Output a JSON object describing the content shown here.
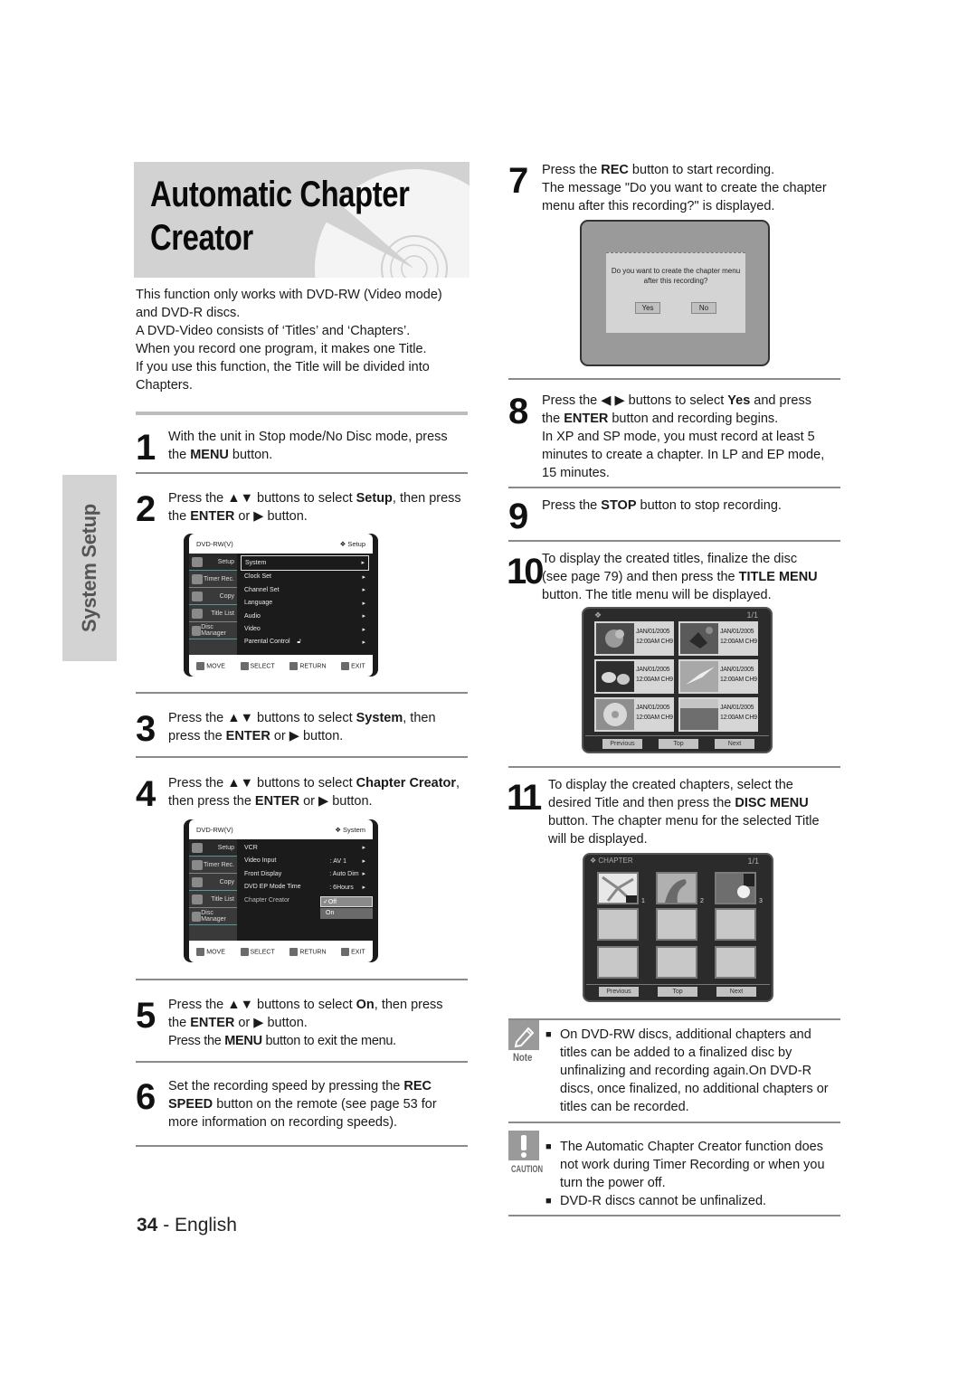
{
  "page": {
    "title_line1": "Automatic Chapter",
    "title_line2": "Creator",
    "side_tab": "System Setup",
    "footer_number": "34",
    "footer_sep": " - ",
    "footer_lang": "English"
  },
  "intro": [
    "This function only works with DVD-RW (Video mode)",
    "and DVD-R discs.",
    "A DVD-Video consists of ‘Titles’ and ‘Chapters’.",
    "When you record one program, it makes one Title.",
    "If you use this function, the Title will be divided into",
    "Chapters."
  ],
  "steps": {
    "s1": {
      "num": "1",
      "l1a": "With the unit in Stop mode/No Disc mode, press",
      "l2a": "the ",
      "l2b": "MENU",
      "l2c": " button."
    },
    "s2": {
      "num": "2",
      "l1a": "Press the ▲▼ buttons to select ",
      "l1b": "Setup",
      "l1c": ", then press",
      "l2a": "the ",
      "l2b": "ENTER",
      "l2c": " or ▶ button."
    },
    "s3": {
      "num": "3",
      "l1a": "Press the ▲▼ buttons to select ",
      "l1b": "System",
      "l1c": ", then",
      "l2a": "press the ",
      "l2b": "ENTER",
      "l2c": " or ▶ button."
    },
    "s4": {
      "num": "4",
      "l1a": "Press the ▲▼ buttons to select ",
      "l1b": "Chapter Creator",
      "l1c": ",",
      "l2a": "then press the ",
      "l2b": "ENTER",
      "l2c": " or ▶ button."
    },
    "s5": {
      "num": "5",
      "l1a": "Press the ▲▼ buttons to select ",
      "l1b": "On",
      "l1c": ", then press",
      "l2a": "the ",
      "l2b": "ENTER",
      "l2c": " or ▶ button.",
      "l3a": "Press the ",
      "l3b": "MENU",
      "l3c": " button to exit the menu."
    },
    "s6": {
      "num": "6",
      "l1a": "Set the recording speed by pressing the ",
      "l1b": "REC",
      "l2a": "SPEED",
      "l2b": " button on the remote (see page 53 for",
      "l3": "more information on recording speeds)."
    },
    "s7": {
      "num": "7",
      "l1a": "Press the ",
      "l1b": "REC",
      "l1c": " button to start recording.",
      "l2": "The message \"Do you want to create the chapter",
      "l3": "menu after this recording?\" is displayed."
    },
    "s8": {
      "num": "8",
      "l1a": "Press the ◀ ▶ buttons to select ",
      "l1b": "Yes",
      "l1c": " and press",
      "l2a": "the ",
      "l2b": "ENTER",
      "l2c": " button and recording begins.",
      "l3": "In XP and SP mode, you must record at least 5",
      "l4": "minutes to create a chapter. In LP and EP mode,",
      "l5": "15 minutes."
    },
    "s9": {
      "num": "9",
      "l1a": "Press the ",
      "l1b": "STOP",
      "l1c": " button to stop recording."
    },
    "s10": {
      "num": "10",
      "l1": "To display the created titles, finalize the disc",
      "l2a": "(see page 79) and then press the ",
      "l2b": "TITLE MENU",
      "l3": "button. The title menu will be displayed."
    },
    "s11": {
      "num": "11",
      "l1": "To display the created chapters, select the",
      "l2a": "desired Title and then press the ",
      "l2b": "DISC MENU",
      "l3": "button. The chapter menu for the selected Title",
      "l4": "will be displayed."
    }
  },
  "osd_setup": {
    "header_left": "DVD-RW(V)",
    "header_right": "❖ Setup",
    "side": [
      "Setup",
      "Timer Rec.",
      "Copy",
      "Title List",
      "Disc Manager"
    ],
    "items": [
      "System",
      "Clock Set",
      "Channel Set",
      "Language",
      "Audio",
      "Video",
      "Parental Control"
    ],
    "selected": "System",
    "footer": [
      "MOVE",
      "SELECT",
      "RETURN",
      "EXIT"
    ]
  },
  "osd_system": {
    "header_left": "DVD-RW(V)",
    "header_right": "❖ System",
    "side": [
      "Setup",
      "Timer Rec.",
      "Copy",
      "Title List",
      "Disc Manager"
    ],
    "items": [
      {
        "label": "VCR",
        "value": ""
      },
      {
        "label": "Video Input",
        "value": ": AV 1"
      },
      {
        "label": "Front Display",
        "value": ": Auto Dim"
      },
      {
        "label": "DVD EP Mode Time",
        "value": ": 6Hours"
      },
      {
        "label": "Chapter Creator",
        "value": ""
      }
    ],
    "options": [
      "✓Off",
      "On"
    ],
    "footer": [
      "MOVE",
      "SELECT",
      "RETURN",
      "EXIT"
    ]
  },
  "dialog": {
    "line1": "Do you  want to create the chapter menu",
    "line2": "after this recording?",
    "yes": "Yes",
    "no": "No"
  },
  "title_menu": {
    "page": "1/1",
    "items": [
      {
        "date": "JAN/01/2005",
        "time": "12:00AM CH9"
      },
      {
        "date": "JAN/01/2005",
        "time": "12:00AM CH9"
      },
      {
        "date": "JAN/01/2005",
        "time": "12:00AM CH9"
      },
      {
        "date": "JAN/01/2005",
        "time": "12:00AM CH9"
      },
      {
        "date": "JAN/01/2005",
        "time": "12:00AM CH9"
      },
      {
        "date": "JAN/01/2005",
        "time": "12:00AM CH9"
      }
    ],
    "buttons": [
      "Previous",
      "Top",
      "Next"
    ]
  },
  "chapter_menu": {
    "title": "CHAPTER",
    "page": "1/1",
    "numbers": [
      "1",
      "2",
      "3"
    ],
    "buttons": [
      "Previous",
      "Top",
      "Next"
    ]
  },
  "note": {
    "label": "Note",
    "l1": "On DVD-RW discs, additional chapters and",
    "l2": "titles can be added to a finalized disc by",
    "l3": "unfinalizing and recording again.On DVD-R",
    "l4": "discs, once finalized, no additional chapters or",
    "l5": "titles can be recorded."
  },
  "caution": {
    "label": "CAUTION",
    "b1l1": "The Automatic Chapter Creator function does",
    "b1l2": "not work during Timer Recording or when you",
    "b1l3": "turn the power off.",
    "b2": "DVD-R discs cannot be unfinalized."
  }
}
